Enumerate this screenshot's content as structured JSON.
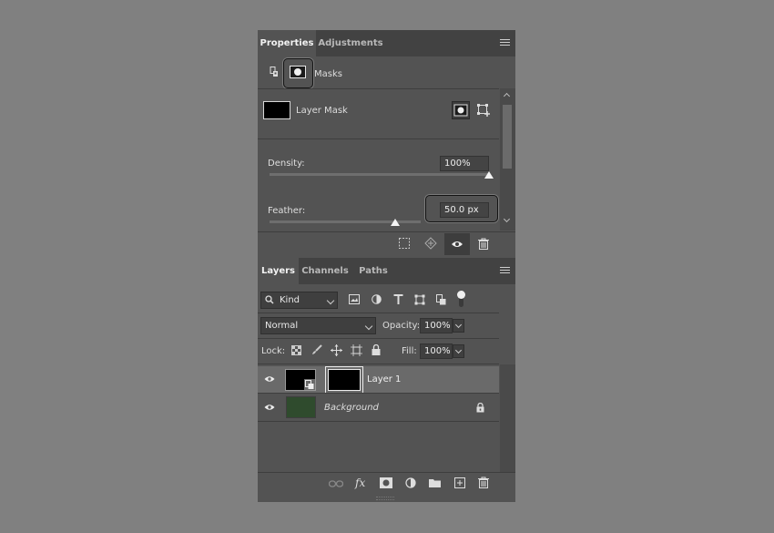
{
  "properties": {
    "tabs": [
      {
        "label": "Properties"
      },
      {
        "label": "Adjustments"
      }
    ],
    "section_label": "Masks",
    "mask_title": "Layer Mask",
    "density": {
      "label": "Density:",
      "value": "100%",
      "level_percent": 100
    },
    "feather": {
      "label": "Feather:",
      "value": "50.0 px",
      "level_fraction": 0.5
    }
  },
  "layers": {
    "tabs": [
      {
        "label": "Layers"
      },
      {
        "label": "Channels"
      },
      {
        "label": "Paths"
      }
    ],
    "filter": {
      "label": "Kind"
    },
    "blend_mode": "Normal",
    "opacity": {
      "label": "Opacity:",
      "value": "100%"
    },
    "lock": {
      "label": "Lock:"
    },
    "fill": {
      "label": "Fill:",
      "value": "100%"
    },
    "items": [
      {
        "name": "Layer 1",
        "selected": true
      },
      {
        "name": "Background",
        "thumb_color": "#2f4b2d"
      }
    ]
  },
  "colors": {
    "panel": "#535353",
    "tabbar": "#424242",
    "selected_row": "#6a6a6a",
    "background": "#808080"
  }
}
